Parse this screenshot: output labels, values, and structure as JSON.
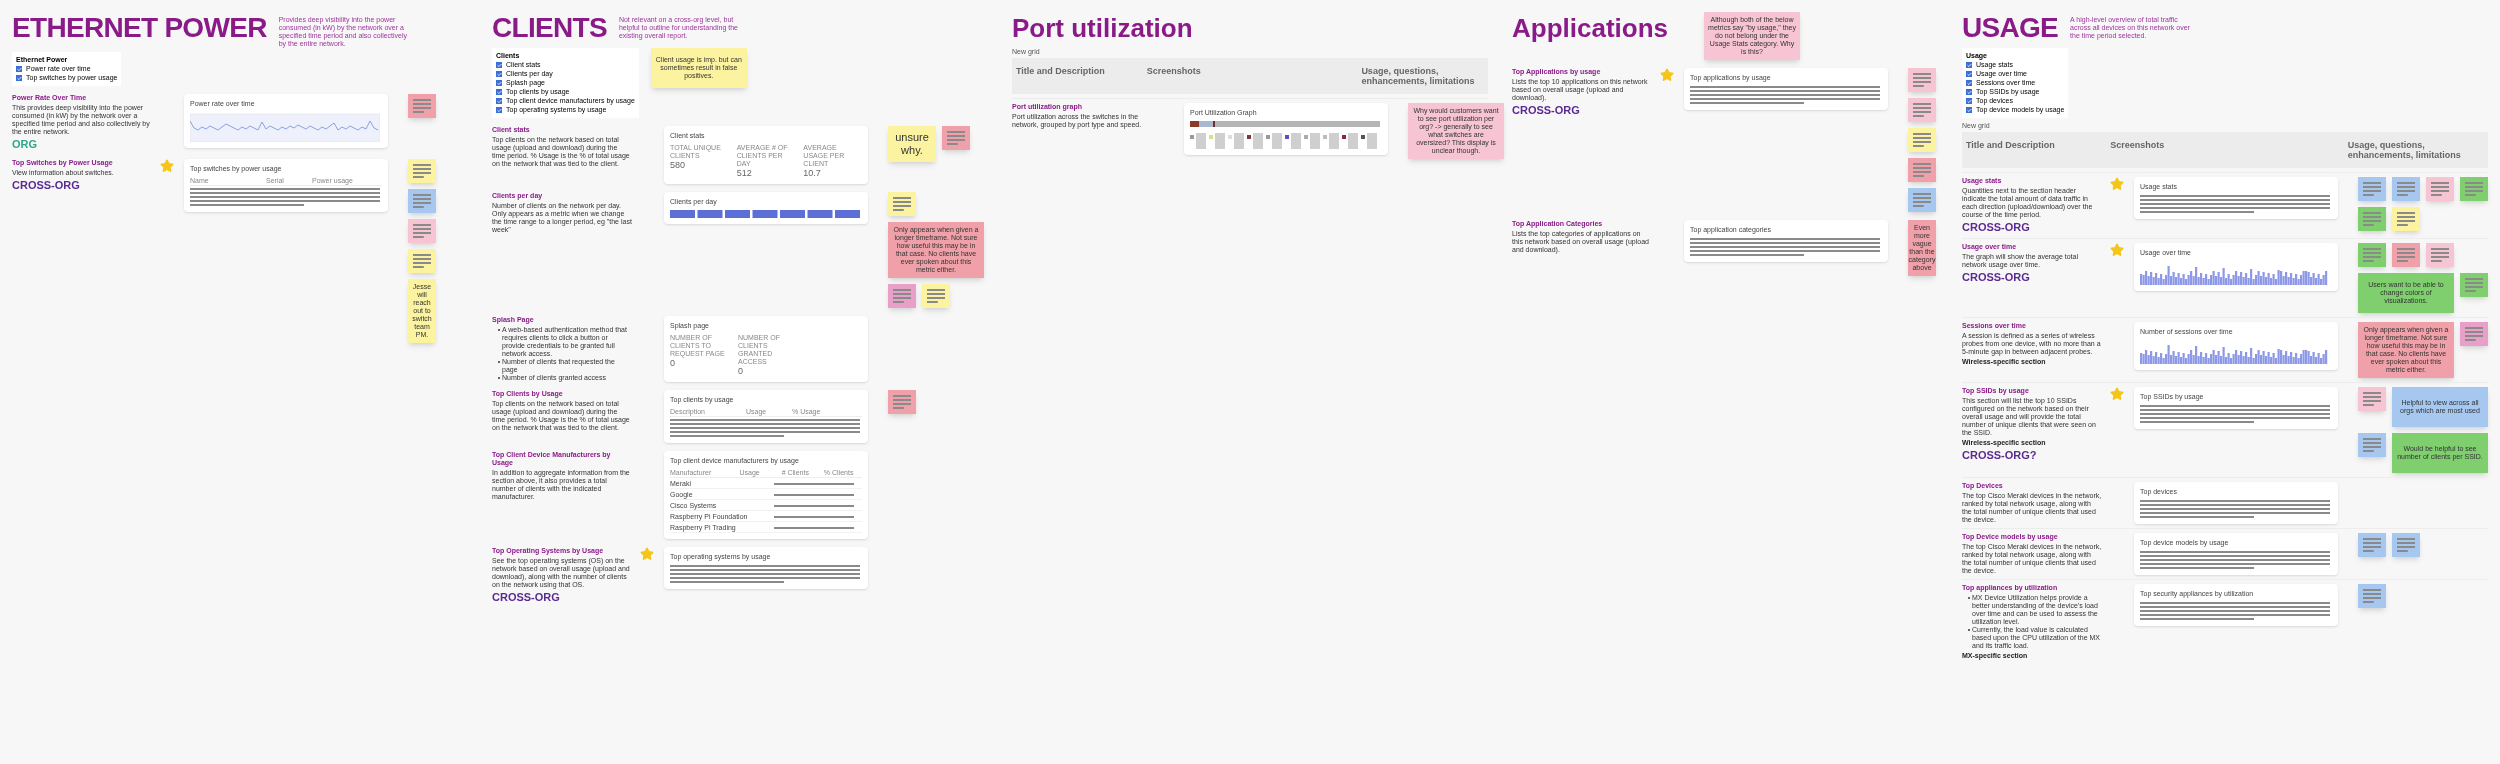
{
  "sections": [
    {
      "title": "ETHERNET POWER",
      "kind": "caps",
      "description": "Provides deep visibility into the power consumed (in kW) by the network over a specified time period and also collectively by the entire network.",
      "checklist": {
        "title": "Ethernet Power",
        "items": [
          {
            "label": "Power rate over time",
            "checked": true
          },
          {
            "label": "Top switches by power usage",
            "checked": true
          }
        ]
      },
      "rows": [
        {
          "title": "Power Rate Over Time",
          "description": "This provides deep visibility into the power consumed (in kW) by the network over a specified time period and also collectively by the entire network.",
          "scope": {
            "text": "ORG",
            "color": "#2aa889"
          },
          "starred": false,
          "card": {
            "kind": "line_chart",
            "title": "Power rate over time"
          },
          "notes": [
            {
              "color": "#f0a0a8"
            }
          ]
        },
        {
          "title": "Top Switches by Power Usage",
          "description": "View information about switches.",
          "scope": {
            "text": "CROSS-ORG",
            "color": "#5b2a91"
          },
          "starred": true,
          "card": {
            "kind": "table",
            "title": "Top switches by power usage",
            "columns": [
              "Name",
              "Serial",
              "Power usage"
            ]
          },
          "notes": [
            {
              "color": "#fbf3a0"
            },
            {
              "color": "#a6c8f0"
            },
            {
              "color": "#f6c4d2"
            },
            {
              "color": "#fbf3a0"
            },
            {
              "text": "Jesse will reach out to switch team PM.",
              "color": "#fbf3a0"
            }
          ]
        }
      ]
    },
    {
      "title": "CLIENTS",
      "kind": "caps",
      "description": "Not relevant on a cross-org level, but helpful to outline for understanding the existing overall report.",
      "checklist": {
        "title": "Clients",
        "items": [
          {
            "label": "Client stats",
            "checked": true
          },
          {
            "label": "Clients per day",
            "checked": true
          },
          {
            "label": "Splash page",
            "checked": true
          },
          {
            "label": "Top clients by usage",
            "checked": true
          },
          {
            "label": "Top client device manufacturers by usage",
            "checked": true
          },
          {
            "label": "Top operating systems by usage",
            "checked": true
          }
        ]
      },
      "checklist_note": {
        "text": "Client usage is imp. but can sometimes result in false positives.",
        "color": "#fbf3a0"
      },
      "rows": [
        {
          "title": "Client stats",
          "description": "Top clients on the network based on total usage (upload and download) during the time period. % Usage is the % of total usage on the network that was tied to the client.",
          "starred": false,
          "card": {
            "kind": "stats",
            "title": "Client stats",
            "stats": [
              {
                "label": "TOTAL UNIQUE CLIENTS",
                "value": "580"
              },
              {
                "label": "AVERAGE # OF CLIENTS PER DAY",
                "value": "512"
              },
              {
                "label": "AVERAGE USAGE PER CLIENT",
                "value": "10.7"
              }
            ]
          },
          "notes": [
            {
              "text": "unsure why.",
              "color": "#fbf3a0"
            },
            {
              "color": "#f0a0a8"
            }
          ]
        },
        {
          "title": "Clients per day",
          "description": "Number of clients on the network per day. Only appears as a metric when we change the time range to a longer period, eg \"the last week\"",
          "starred": false,
          "card": {
            "kind": "bars",
            "title": "Clients per day"
          },
          "notes": [
            {
              "color": "#fbf3a0"
            },
            {
              "text": "Only appears when given a longer timeframe. Not sure how useful this may be in that case. No clients have ever spoken about this metric either.",
              "color": "#f0a0a8"
            },
            {
              "color": "#e8a0c8"
            },
            {
              "color": "#fbf3a0"
            }
          ]
        },
        {
          "title": "Splash Page",
          "bullets": [
            "A web-based authentication method that requires clients to click a button or provide credentials to be granted full network access.",
            "Number of clients that requested the page",
            "Number of clients granted access"
          ],
          "starred": false,
          "card": {
            "kind": "stats",
            "title": "Splash page",
            "stats": [
              {
                "label": "NUMBER OF CLIENTS TO REQUEST PAGE",
                "value": "0"
              },
              {
                "label": "NUMBER OF CLIENTS GRANTED ACCESS",
                "value": "0"
              }
            ]
          },
          "notes": []
        },
        {
          "title": "Top Clients by Usage",
          "description": "Top clients on the network based on total usage (upload and download) during the time period. % Usage is the % of total usage on the network that was tied to the client.",
          "starred": false,
          "card": {
            "kind": "table",
            "title": "Top clients by usage",
            "columns": [
              "Description",
              "Usage",
              "% Usage"
            ]
          },
          "notes": [
            {
              "color": "#f0a0a8"
            }
          ]
        },
        {
          "title": "Top Client Device Manufacturers by Usage",
          "description": "In addition to aggregate information from the section above, it also provides a total number of clients with the indicated manufacturer.",
          "starred": false,
          "card": {
            "kind": "table",
            "title": "Top client device manufacturers by usage",
            "columns": [
              "Manufacturer",
              "Usage",
              "# Clients",
              "% Clients"
            ],
            "rows": [
              [
                "Meraki"
              ],
              [
                "Google"
              ],
              [
                "Cisco Systems"
              ],
              [
                "Raspberry Pi Foundation"
              ],
              [
                "Raspberry Pi Trading"
              ]
            ]
          },
          "notes": []
        },
        {
          "title": "Top Operating Systems by Usage",
          "description": "See the top operating systems (OS) on the network based on overall usage (upload and download), along with the number of clients on the network using that OS.",
          "scope": {
            "text": "CROSS-ORG",
            "color": "#5b2a91"
          },
          "starred": true,
          "card": {
            "kind": "table",
            "title": "Top operating systems by usage"
          },
          "notes": []
        }
      ]
    },
    {
      "title": "Port utilization",
      "kind": "normal",
      "grid_label": "New grid",
      "header": [
        "Title and Description",
        "Screenshots",
        "Usage, questions, enhancements, limitations"
      ],
      "rows": [
        {
          "title": "Port utilization graph",
          "description": "Port utilization across the switches in the network, grouped by port type and speed.",
          "starred": false,
          "card": {
            "kind": "stacked_bar",
            "title": "Port Utilization Graph"
          },
          "notes": [
            {
              "text": "Why would customers want to see port utilization per org? -> generally to see what switches are oversized? This display is unclear though.",
              "color": "#f6c4d2"
            }
          ]
        }
      ]
    },
    {
      "title": "Applications",
      "kind": "normal",
      "title_note": {
        "text": "Although both of the below metrics say \"by usage,\" they do not belong under the Usage Stats category. Why is this?",
        "color": "#f6c4d2"
      },
      "rows": [
        {
          "title": "Top Applications by usage",
          "description": "Lists the top 10 applications on this network based on overall usage (upload and download).",
          "scope": {
            "text": "CROSS-ORG",
            "color": "#5b2a91"
          },
          "starred": true,
          "card": {
            "kind": "table",
            "title": "Top applications by usage"
          },
          "notes": [
            {
              "color": "#f6c4d2"
            },
            {
              "color": "#f6c4d2"
            },
            {
              "color": "#fbf3a0"
            },
            {
              "color": "#f0a0a8"
            },
            {
              "color": "#a6c8f0"
            }
          ]
        },
        {
          "title": "Top Application Categories",
          "description": "Lists the top categories of applications on this network based on overall usage (upload and download).",
          "starred": false,
          "card": {
            "kind": "table",
            "title": "Top application categories"
          },
          "notes": [
            {
              "text": "Even more vague than the category above",
              "color": "#f0a0a8"
            }
          ]
        }
      ]
    },
    {
      "title": "USAGE",
      "kind": "caps",
      "description": "A high-level overview of total traffic across all devices on this network over the time period selected.",
      "checklist": {
        "title": "Usage",
        "items": [
          {
            "label": "Usage stats",
            "checked": true
          },
          {
            "label": "Usage over time",
            "checked": true
          },
          {
            "label": "Sessions over time",
            "checked": true
          },
          {
            "label": "Top SSIDs by usage",
            "checked": true
          },
          {
            "label": "Top devices",
            "checked": true
          },
          {
            "label": "Top device models by usage",
            "checked": true
          }
        ]
      },
      "grid_label": "New grid",
      "header": [
        "Title and Description",
        "Screenshots",
        "Usage, questions, enhancements, limitations"
      ],
      "rows": [
        {
          "title": "Usage stats",
          "description": "Quantities next to the section header indicate the total amount of data traffic in each direction (upload/download) over the course of the time period.",
          "scope": {
            "text": "CROSS-ORG",
            "color": "#5b2a91"
          },
          "starred": true,
          "card": {
            "kind": "table",
            "title": "Usage stats"
          },
          "notes": [
            {
              "color": "#a6c8f0"
            },
            {
              "color": "#a6c8f0"
            },
            {
              "color": "#f6c4d2"
            },
            {
              "color": "#7fcf6f"
            },
            {
              "color": "#7fcf6f"
            },
            {
              "color": "#fbf3a0"
            }
          ]
        },
        {
          "title": "Usage over time",
          "description": "The graph will show the average total network usage over time.",
          "scope": {
            "text": "CROSS-ORG",
            "color": "#5b2a91"
          },
          "starred": true,
          "card": {
            "kind": "area_chart",
            "title": "Usage over time"
          },
          "notes": [
            {
              "color": "#7fcf6f"
            },
            {
              "color": "#f0a0a8"
            },
            {
              "color": "#f6c4d2"
            },
            {
              "text": "Users want to be able to change colors of visualizations.",
              "color": "#7fcf6f"
            },
            {
              "color": "#7fcf6f"
            }
          ]
        },
        {
          "title": "Sessions over time",
          "description": "A session is defined as a series of wireless probes from one device, with no more than a 5-minute gap in between adjacent probes.",
          "bold_line": "Wireless-specific section",
          "starred": false,
          "card": {
            "kind": "area_chart",
            "title": "Number of sessions over time"
          },
          "notes": [
            {
              "text": "Only appears when given a longer timeframe. Not sure how useful this may be in that case. No clients have ever spoken about this metric either.",
              "color": "#f0a0a8"
            },
            {
              "color": "#e8a0c8"
            }
          ]
        },
        {
          "title": "Top SSIDs by usage",
          "description": "This section will list the top 10 SSIDs configured on the network based on their overall usage and will provide the total number of unique clients that were seen on the SSID.",
          "bold_line": "Wireless-specific section",
          "scope": {
            "text": "CROSS-ORG?",
            "color": "#5b2a91"
          },
          "starred": true,
          "card": {
            "kind": "table",
            "title": "Top SSIDs by usage"
          },
          "notes": [
            {
              "color": "#f6c4d2"
            },
            {
              "text": "Helpful to view across all orgs which are most used",
              "color": "#a6c8f0"
            },
            {
              "color": "#a6c8f0"
            },
            {
              "text": "Would be helpful to see number of clients per SSID.",
              "color": "#7fcf6f"
            }
          ]
        },
        {
          "title": "Top Devices",
          "description": "The top Cisco Meraki devices in the network, ranked by total network usage, along with the total number of unique clients that used the device.",
          "starred": false,
          "card": {
            "kind": "table",
            "title": "Top devices"
          },
          "notes": []
        },
        {
          "title": "Top Device models by usage",
          "description": "The top Cisco Meraki devices in the network, ranked by total network usage, along with the total number of unique clients that used the device.",
          "starred": false,
          "card": {
            "kind": "table",
            "title": "Top device models by usage"
          },
          "notes": [
            {
              "color": "#a6c8f0"
            },
            {
              "color": "#a6c8f0"
            }
          ]
        },
        {
          "title": "Top appliances by utilization",
          "bullets": [
            "MX Device Utilization helps provide a better understanding of the device's load over time and can be used to assess the utilization level.",
            "Currently, the load value is calculated based upon the CPU utilization of the MX and its traffic load."
          ],
          "bold_line": "MX-specific section",
          "starred": false,
          "card": {
            "kind": "table",
            "title": "Top security appliances by utilization"
          },
          "notes": [
            {
              "color": "#a6c8f0"
            }
          ]
        }
      ]
    }
  ]
}
